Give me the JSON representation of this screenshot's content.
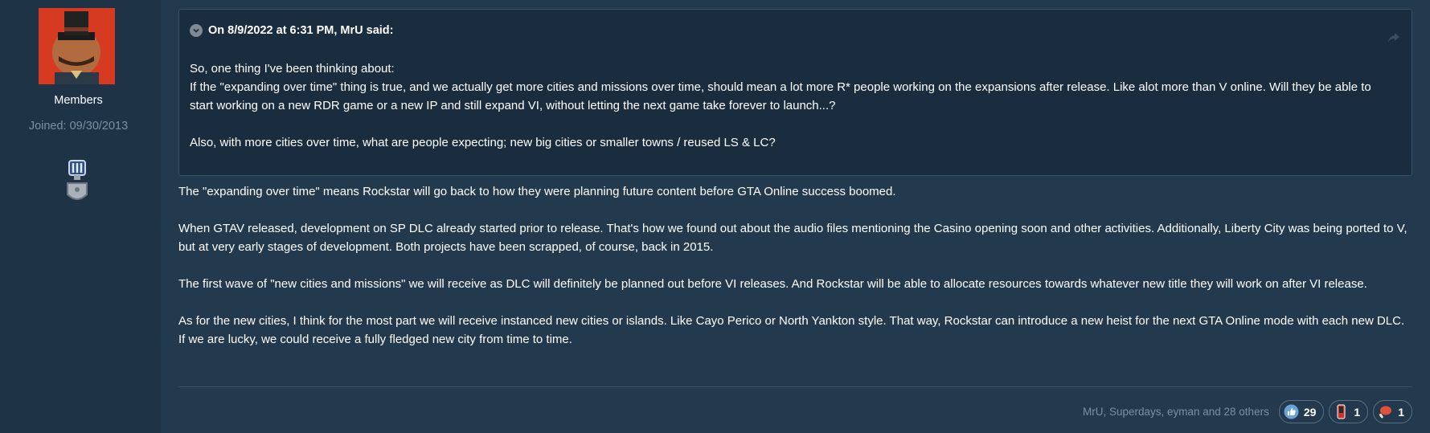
{
  "author": {
    "group": "Members",
    "joined": "Joined: 09/30/2013"
  },
  "quote": {
    "header": "On 8/9/2022 at 6:31 PM, MrU said:",
    "lines": [
      "So, one thing I've been thinking about:",
      "If the \"expanding over time\" thing is true, and we actually get more cities and missions over time, should mean a lot more R* people working on the expansions after release. Like alot more than V online. Will they be able to start working on a new RDR game or a new IP and still expand VI, without letting the next game take forever to launch...?",
      "Also, with more cities over time, what are people expecting; new big cities or smaller towns / reused LS & LC?"
    ]
  },
  "post": {
    "paragraphs": [
      "The \"expanding over time\" means Rockstar will go back to how they were planning future content before GTA Online success boomed.",
      "When GTAV released, development on SP DLC already started prior to release. That's how we found out about the audio files mentioning the Casino opening soon and other activities. Additionally, Liberty City was being ported to V, but at very early stages of development. Both projects have been scrapped, of course, back in 2015.",
      "The first wave of \"new cities and missions\" we will receive as DLC will definitely be planned out before VI releases. And Rockstar will be able to allocate resources towards whatever new title they will work on after VI release.",
      "As for the new cities, I think for the most part we will receive instanced new cities or islands. Like Cayo Perico or North Yankton style. That way, Rockstar can introduce a new heist for the next GTA Online mode with each new DLC. If we are lucky, we could receive a fully fledged new city from time to time."
    ]
  },
  "reactions": {
    "summary": "MrU, Superdays, eyman and 28 others",
    "items": [
      {
        "icon": "thumbs-up-icon",
        "count": "29"
      },
      {
        "icon": "phone-icon",
        "count": "1"
      },
      {
        "icon": "meat-icon",
        "count": "1"
      }
    ]
  },
  "colors": {
    "background": "#23394d",
    "sidebar": "#1f3347",
    "quote_bg": "#1a2d3f",
    "muted": "#7d90a3"
  }
}
